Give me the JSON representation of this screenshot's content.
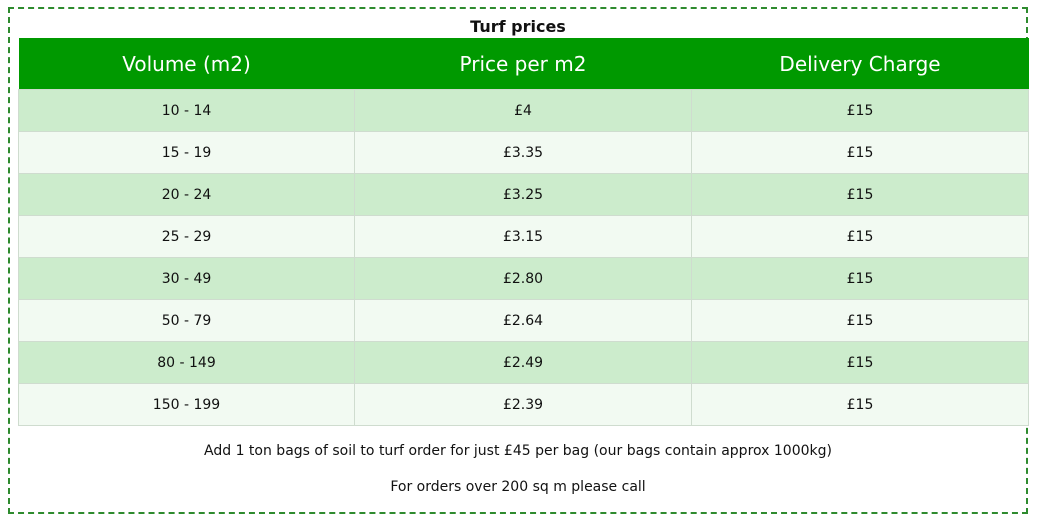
{
  "table_title": "Turf prices",
  "columns": [
    "Volume (m2)",
    "Price per m2",
    "Delivery Charge"
  ],
  "rows": [
    {
      "volume": "10 - 14",
      "price": "£4",
      "delivery": "£15"
    },
    {
      "volume": "15 - 19",
      "price": "£3.35",
      "delivery": "£15"
    },
    {
      "volume": "20 - 24",
      "price": "£3.25",
      "delivery": "£15"
    },
    {
      "volume": "25 - 29",
      "price": "£3.15",
      "delivery": "£15"
    },
    {
      "volume": "30 - 49",
      "price": "£2.80",
      "delivery": "£15"
    },
    {
      "volume": "50 - 79",
      "price": "£2.64",
      "delivery": "£15"
    },
    {
      "volume": "80 - 149",
      "price": "£2.49",
      "delivery": "£15"
    },
    {
      "volume": "150 - 199",
      "price": "£2.39",
      "delivery": "£15"
    }
  ],
  "notes": {
    "soil_offer": "Add 1 ton bags of soil to turf order for just £45 per bag (our bags contain approx 1000kg)",
    "large_orders": "For orders over 200 sq m please call"
  },
  "colors": {
    "header_green": "#009900",
    "row_light_green": "#cceccc",
    "row_pale_green": "#f2faf2",
    "frame_border": "#2e8b2e"
  }
}
